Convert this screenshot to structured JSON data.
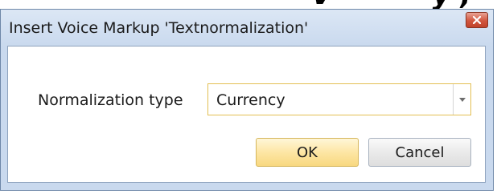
{
  "background": {
    "fragment_text": "V      ~     ~   ~y ,"
  },
  "dialog": {
    "title": "Insert Voice Markup 'Textnormalization'",
    "close_label": "×",
    "field_label": "Normalization type",
    "select": {
      "value": "Currency"
    },
    "ok_label": "OK",
    "cancel_label": "Cancel"
  },
  "colors": {
    "window_frame": "#c9d9ee",
    "ok_button": "#fde6a4",
    "select_border": "#e3bf53",
    "close_button": "#d1563e"
  }
}
